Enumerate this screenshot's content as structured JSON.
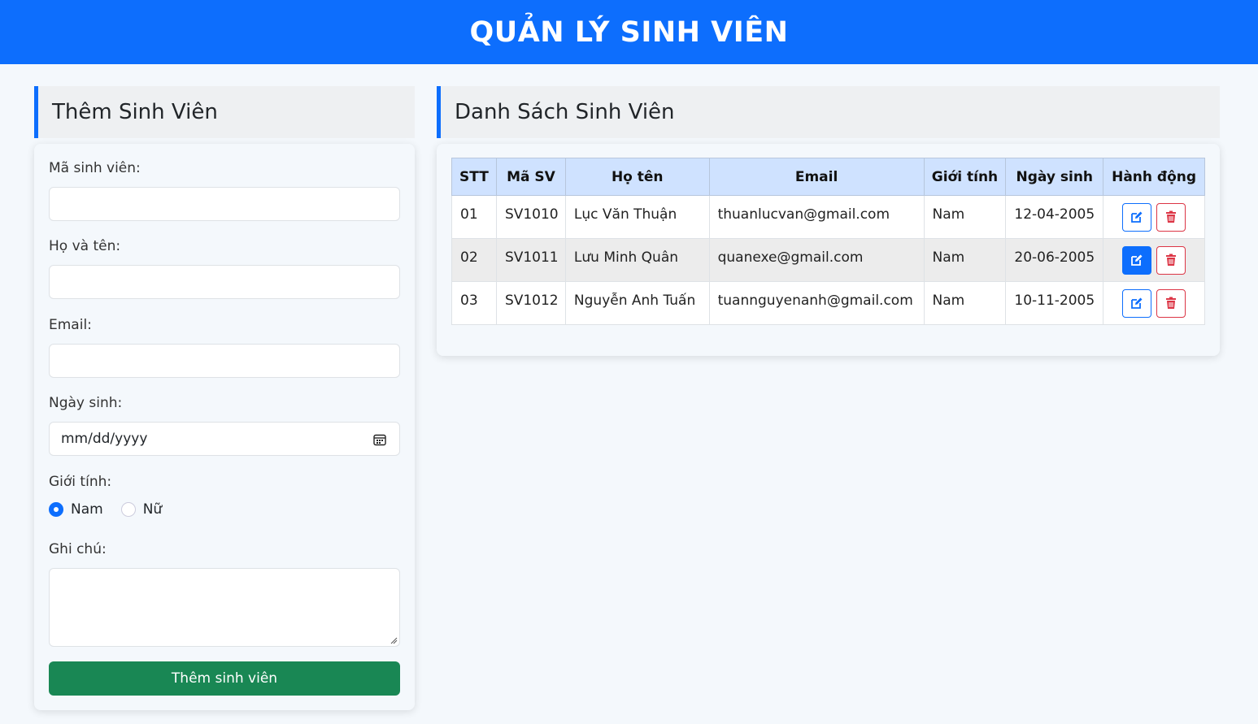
{
  "header": {
    "title": "QUẢN LÝ SINH VIÊN"
  },
  "form": {
    "title": "Thêm Sinh Viên",
    "fields": {
      "student_id": {
        "label": "Mã sinh viên:",
        "value": ""
      },
      "full_name": {
        "label": "Họ và tên:",
        "value": ""
      },
      "email": {
        "label": "Email:",
        "value": ""
      },
      "dob": {
        "label": "Ngày sinh:",
        "placeholder": "mm/dd/yyyy"
      },
      "gender": {
        "label": "Giới tính:",
        "options": [
          "Nam",
          "Nữ"
        ],
        "selected": "Nam"
      },
      "note": {
        "label": "Ghi chú:",
        "value": ""
      }
    },
    "submit_label": "Thêm sinh viên"
  },
  "list": {
    "title": "Danh Sách Sinh Viên",
    "columns": [
      "STT",
      "Mã SV",
      "Họ tên",
      "Email",
      "Giới tính",
      "Ngày sinh",
      "Hành động"
    ],
    "rows": [
      [
        "01",
        "SV1010",
        "Lục Văn Thuận",
        "thuanlucvan@gmail.com",
        "Nam",
        "12-04-2005"
      ],
      [
        "02",
        "SV1011",
        "Lưu Minh Quân",
        "quanexe@gmail.com",
        "Nam",
        "20-06-2005"
      ],
      [
        "03",
        "SV1012",
        "Nguyễn Anh Tuấn",
        "tuannguyenanh@gmail.com",
        "Nam",
        "10-11-2005"
      ]
    ],
    "actions": {
      "edit_icon": "edit-icon",
      "delete_icon": "trash-icon"
    }
  },
  "colors": {
    "primary": "#0d6efd",
    "success": "#198754",
    "danger": "#dc3545",
    "table_header": "#cfe2ff"
  }
}
